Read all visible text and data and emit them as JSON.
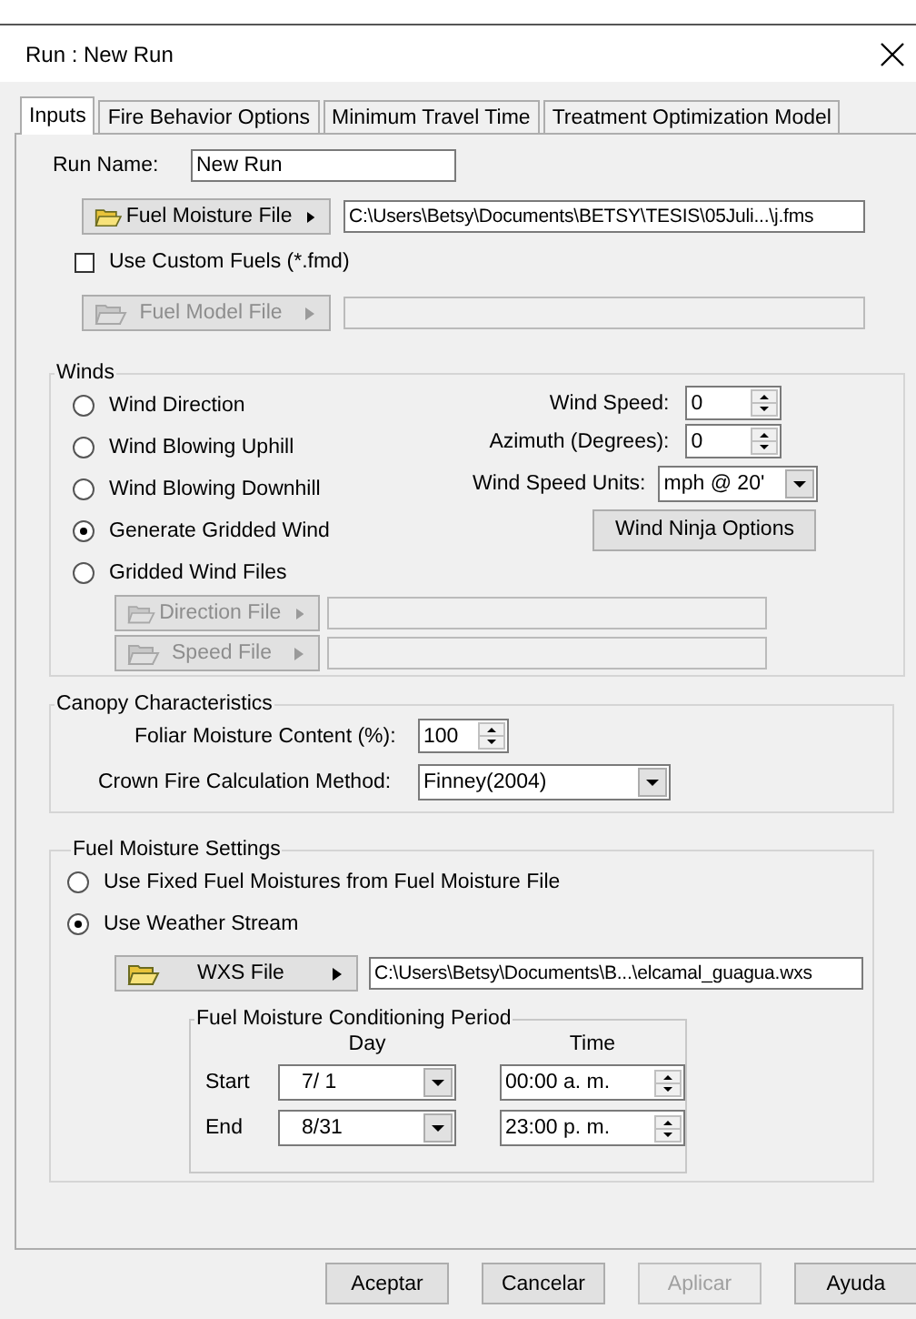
{
  "window": {
    "title": "Run : New Run"
  },
  "tabs": [
    {
      "label": "Inputs",
      "selected": true
    },
    {
      "label": "Fire Behavior Options",
      "selected": false
    },
    {
      "label": "Minimum Travel Time",
      "selected": false
    },
    {
      "label": "Treatment Optimization Model",
      "selected": false
    }
  ],
  "run_name": {
    "label": "Run Name:",
    "value": "New Run"
  },
  "fuel_moisture_file": {
    "button": "Fuel Moisture File",
    "disabled": false,
    "path": "C:\\Users\\Betsy\\Documents\\BETSY\\TESIS\\05Juli...\\j.fms"
  },
  "custom_fuels": {
    "label": "Use Custom Fuels (*.fmd)",
    "checked": false
  },
  "fuel_model_file": {
    "button": "Fuel Model File",
    "disabled": true
  },
  "winds": {
    "title": "Winds",
    "options": [
      {
        "label": "Wind Direction",
        "selected": false
      },
      {
        "label": "Wind Blowing Uphill",
        "selected": false
      },
      {
        "label": "Wind Blowing Downhill",
        "selected": false
      },
      {
        "label": "Generate Gridded Wind",
        "selected": true
      },
      {
        "label": "Gridded Wind Files",
        "selected": false
      }
    ],
    "wind_speed": {
      "label": "Wind Speed:",
      "value": "0"
    },
    "azimuth": {
      "label": "Azimuth (Degrees):",
      "value": "0"
    },
    "units": {
      "label": "Wind Speed Units:",
      "value": "mph @ 20'"
    },
    "ninja_button": "Wind Ninja Options",
    "direction_file": {
      "button": "Direction File",
      "disabled": true
    },
    "speed_file": {
      "button": "Speed File",
      "disabled": true
    }
  },
  "canopy": {
    "title": "Canopy Characteristics",
    "foliar": {
      "label": "Foliar Moisture Content (%):",
      "value": "100"
    },
    "crown": {
      "label": "Crown Fire Calculation Method:",
      "value": "Finney(2004)"
    }
  },
  "fuel_moisture_settings": {
    "title": "Fuel Moisture Settings",
    "options": [
      {
        "label": "Use Fixed Fuel Moistures from Fuel Moisture File",
        "selected": false
      },
      {
        "label": "Use Weather Stream",
        "selected": true
      }
    ],
    "wxs_file": {
      "button": "WXS File",
      "disabled": false,
      "path": "C:\\Users\\Betsy\\Documents\\B...\\elcamal_guagua.wxs"
    },
    "conditioning": {
      "title": "Fuel Moisture Conditioning Period",
      "day_header": "Day",
      "time_header": "Time",
      "rows": [
        {
          "label": "Start",
          "day": "7/ 1",
          "time": "00:00 a. m."
        },
        {
          "label": "End",
          "day": "8/31",
          "time": "23:00 p. m."
        }
      ]
    }
  },
  "buttons": [
    {
      "label": "Aceptar",
      "disabled": false
    },
    {
      "label": "Cancelar",
      "disabled": false
    },
    {
      "label": "Aplicar",
      "disabled": true
    },
    {
      "label": "Ayuda",
      "disabled": false
    }
  ]
}
